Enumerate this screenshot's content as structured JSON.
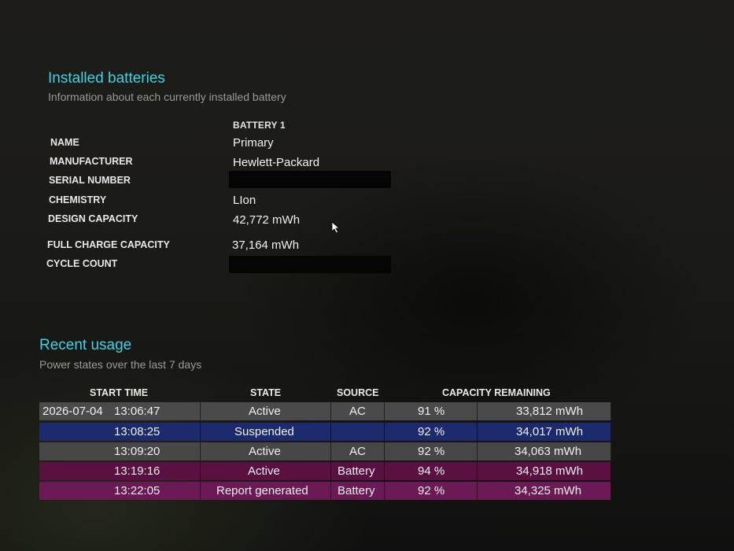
{
  "installed": {
    "title": "Installed batteries",
    "subtitle": "Information about each currently installed battery",
    "column_header": "BATTERY 1",
    "properties": [
      {
        "label": "NAME",
        "value": "Primary"
      },
      {
        "label": "MANUFACTURER",
        "value": "Hewlett-Packard"
      },
      {
        "label": "SERIAL NUMBER",
        "value": ""
      },
      {
        "label": "CHEMISTRY",
        "value": "LIon"
      },
      {
        "label": "DESIGN CAPACITY",
        "value": "42,772 mWh"
      },
      {
        "label": "FULL CHARGE CAPACITY",
        "value": "37,164 mWh"
      },
      {
        "label": "CYCLE COUNT",
        "value": ""
      }
    ]
  },
  "usage": {
    "title": "Recent usage",
    "subtitle": "Power states over the last 7 days",
    "headers": {
      "start_time": "START TIME",
      "state": "STATE",
      "source": "SOURCE",
      "capacity": "CAPACITY REMAINING"
    },
    "rows": [
      {
        "date": "2026-07-04",
        "time": "13:06:47",
        "state": "Active",
        "source": "AC",
        "percent": "91 %",
        "mwh": "33,812 mWh",
        "color": "#4a4a4a"
      },
      {
        "date": "",
        "time": "13:08:25",
        "state": "Suspended",
        "source": "",
        "percent": "92 %",
        "mwh": "34,017 mWh",
        "color": "#1c2a6e"
      },
      {
        "date": "",
        "time": "13:09:20",
        "state": "Active",
        "source": "AC",
        "percent": "92 %",
        "mwh": "34,063 mWh",
        "color": "#474747"
      },
      {
        "date": "",
        "time": "13:19:16",
        "state": "Active",
        "source": "Battery",
        "percent": "94 %",
        "mwh": "34,918 mWh",
        "color": "#5a1040"
      },
      {
        "date": "",
        "time": "13:22:05",
        "state": "Report generated",
        "source": "Battery",
        "percent": "92 %",
        "mwh": "34,325 mWh",
        "color": "#6b1a55"
      }
    ]
  },
  "colors": {
    "title_accent": "#3ad3e8",
    "active_ac": "#4a4a4a",
    "suspended": "#1c2a6e",
    "battery": "#6b1a55"
  }
}
